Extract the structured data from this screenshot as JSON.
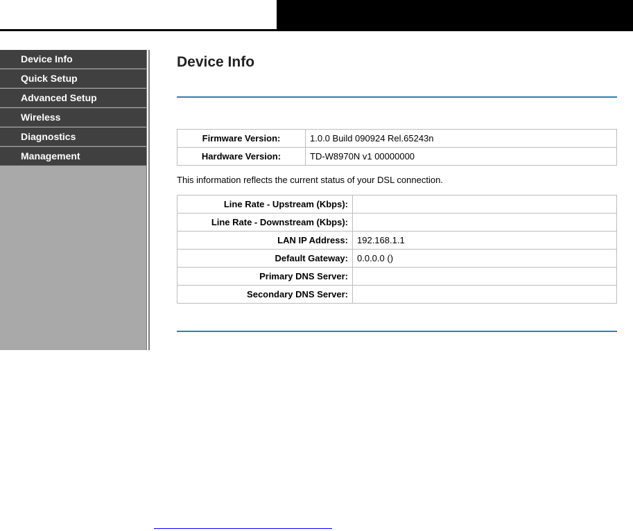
{
  "sidebar": {
    "items": [
      {
        "label": "Device Info"
      },
      {
        "label": "Quick Setup"
      },
      {
        "label": "Advanced Setup"
      },
      {
        "label": "Wireless"
      },
      {
        "label": "Diagnostics"
      },
      {
        "label": "Management"
      }
    ]
  },
  "main": {
    "title": "Device Info",
    "version_table": [
      {
        "label": "Firmware Version:",
        "value": "1.0.0 Build 090924 Rel.65243n"
      },
      {
        "label": "Hardware Version:",
        "value": "TD-W8970N v1 00000000"
      }
    ],
    "status_note": "This information reflects the current status of your DSL connection.",
    "status_table": [
      {
        "label": "Line Rate - Upstream (Kbps):",
        "value": ""
      },
      {
        "label": "Line Rate - Downstream (Kbps):",
        "value": ""
      },
      {
        "label": "LAN IP Address:",
        "value": "192.168.1.1"
      },
      {
        "label": "Default Gateway:",
        "value": "0.0.0.0 ()"
      },
      {
        "label": "Primary DNS Server:",
        "value": ""
      },
      {
        "label": "Secondary DNS Server:",
        "value": ""
      }
    ]
  },
  "colors": {
    "sidebar_item": "#404040",
    "sidebar_bg": "#a9a9a9",
    "rule_blue": "#2f7fb1",
    "link_blue": "#0000ff"
  }
}
